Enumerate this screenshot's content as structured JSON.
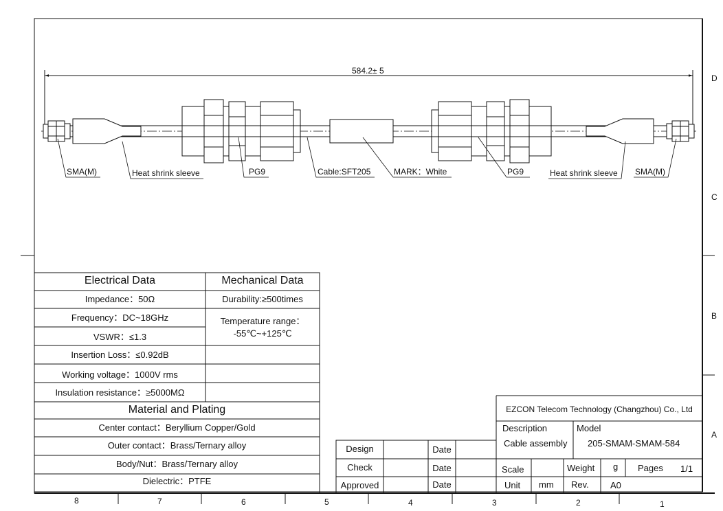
{
  "dimension": {
    "overall_length": "584.2± 5"
  },
  "callouts": {
    "sma_left": "SMA(M)",
    "heat_shrink_left": "Heat shrink sleeve",
    "pg9_left": "PG9",
    "cable": "Cable:SFT205",
    "mark": "MARK：White",
    "pg9_right": "PG9",
    "heat_shrink_right": "Heat shrink sleeve",
    "sma_right": "SMA(M)"
  },
  "zones": {
    "rows": [
      "D",
      "C",
      "B",
      "A"
    ],
    "columns": [
      "8",
      "7",
      "6",
      "5",
      "4",
      "3",
      "2",
      "1"
    ]
  },
  "electrical": {
    "title": "Electrical Data",
    "rows": [
      "Impedance：50Ω",
      "Frequency：DC~18GHz",
      "VSWR：≤1.3",
      "Insertion Loss：≤0.92dB",
      "Working voltage：1000V rms",
      "Insulation resistance：≥5000MΩ"
    ]
  },
  "mechanical": {
    "title": "Mechanical Data",
    "durability": "Durability:≥500times",
    "temp_label": "Temperature range：",
    "temp_value": "-55℃~+125℃"
  },
  "material": {
    "title": "Material and Plating",
    "rows": [
      "Center contact：Beryllium Copper/Gold",
      "Outer contact：Brass/Ternary alloy",
      "Body/Nut：Brass/Ternary alloy",
      "Dielectric：PTFE"
    ]
  },
  "approval": {
    "design": "Design",
    "check": "Check",
    "approved": "Approved",
    "date": "Date"
  },
  "title_block": {
    "company": "EZCON Telecom Technology (Changzhou) Co., Ltd",
    "description_label": "Description",
    "description_value": "Cable assembly",
    "model_label": "Model",
    "model_value": "205-SMAM-SMAM-584",
    "scale_label": "Scale",
    "weight_label": "Weight",
    "weight_value": "g",
    "pages_label": "Pages",
    "pages_value": "1/1",
    "unit_label": "Unit",
    "unit_value": "mm",
    "rev_label": "Rev.",
    "rev_value": "A0"
  }
}
